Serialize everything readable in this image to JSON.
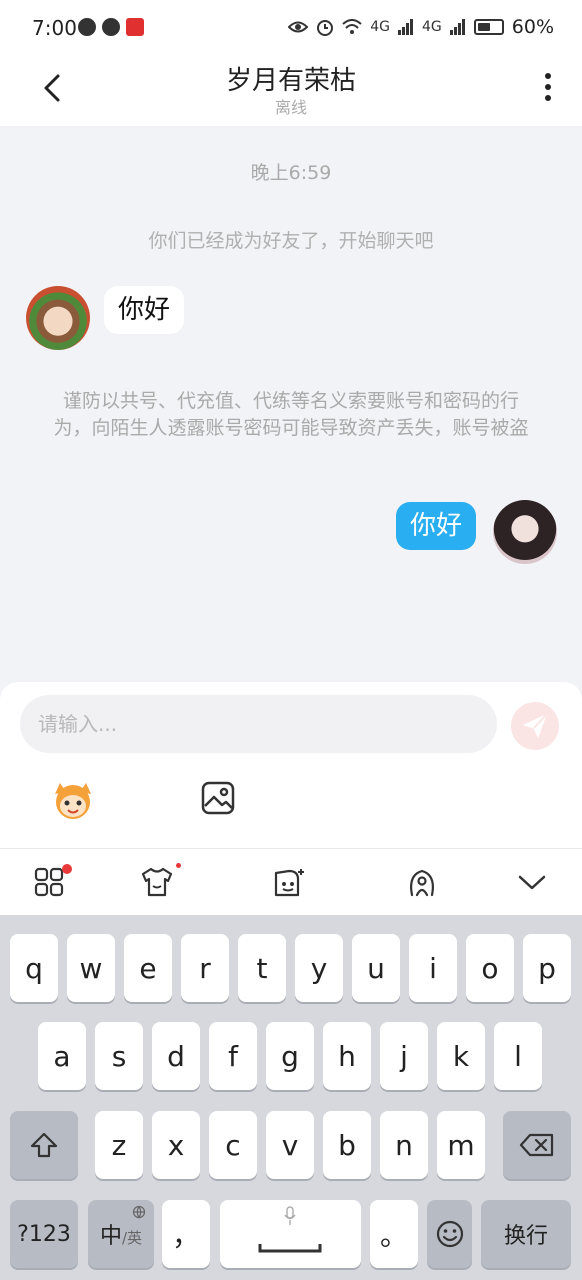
{
  "status_bar": {
    "time": "7:00",
    "net_a": "4G",
    "net_b": "4G",
    "battery_percent": "60%"
  },
  "header": {
    "title": "岁月有荣枯",
    "subtitle": "离线"
  },
  "chat": {
    "timestamp": "晚上6:59",
    "system_message": "你们已经成为好友了，开始聊天吧",
    "incoming_message": "你好",
    "warning": "谨防以共号、代充值、代练等名义索要账号和密码的行为，向陌生人透露账号密码可能导致资产丢失，账号被盗",
    "outgoing_message": "你好"
  },
  "composer": {
    "placeholder": "请输入..."
  },
  "keyboard": {
    "row1": [
      "q",
      "w",
      "e",
      "r",
      "t",
      "y",
      "u",
      "i",
      "o",
      "p"
    ],
    "row2": [
      "a",
      "s",
      "d",
      "f",
      "g",
      "h",
      "j",
      "k",
      "l"
    ],
    "row3": [
      "z",
      "x",
      "c",
      "v",
      "b",
      "n",
      "m"
    ],
    "symbols_key": "?123",
    "lang_key_main": "中",
    "lang_key_sub": "/英",
    "comma_key": "，",
    "period_key": "。",
    "enter_key": "换行"
  },
  "colors": {
    "accent": "#2aaef2",
    "send_disabled": "#fbe4e4",
    "badge": "#e83a3a"
  },
  "icons": {
    "back": "chevron-left-icon",
    "more": "more-vertical-icon",
    "send": "paper-plane-icon",
    "emoji": "mascot-emoji-icon",
    "image": "image-icon",
    "apps": "grid-icon",
    "theme": "tshirt-icon",
    "sticker": "face-sticker-icon",
    "assistant": "assistant-icon",
    "collapse": "chevron-down-icon",
    "backspace": "backspace-icon",
    "mic": "mic-icon",
    "emoji_key": "smile-icon",
    "shift": "shift-icon"
  }
}
